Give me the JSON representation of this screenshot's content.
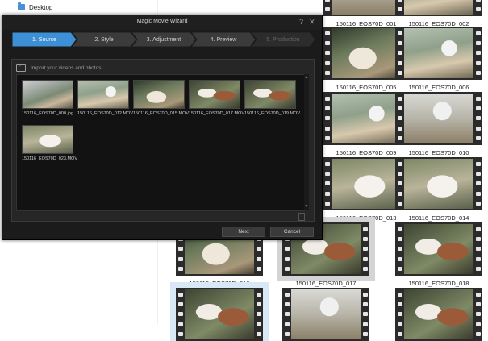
{
  "explorer": {
    "nav_desktop": "Desktop",
    "tiles": [
      {
        "label": "",
        "palette": "p6"
      },
      {
        "label": "150116_EOS70D_001",
        "palette": "p6"
      },
      {
        "label": "150116_EOS70D_002",
        "palette": "p2"
      },
      {
        "label": "150116_EOS70D_005",
        "palette": "p3"
      },
      {
        "label": "150116_EOS70D_006",
        "palette": "p2"
      },
      {
        "label": "150116_EOS70D_009",
        "palette": "p2"
      },
      {
        "label": "150116_EOS70D_010",
        "palette": "p6"
      },
      {
        "label": "150116_EOS70D_013",
        "palette": "p5"
      },
      {
        "label": "150116_EOS70D_014",
        "palette": "p5"
      },
      {
        "label": "150116_EOS70D_016",
        "palette": "p3"
      },
      {
        "label": "150116_EOS70D_017",
        "palette": "p4"
      },
      {
        "label": "150116_EOS70D_018",
        "palette": "p4"
      },
      {
        "label": "",
        "palette": "p4"
      },
      {
        "label": "",
        "palette": "p6"
      },
      {
        "label": "",
        "palette": "p4"
      }
    ]
  },
  "wizard": {
    "title": "Magic Movie Wizard",
    "help_glyph": "?",
    "close_glyph": "✕",
    "steps": [
      {
        "label": "1. Source",
        "state": "active"
      },
      {
        "label": "2. Style",
        "state": "normal"
      },
      {
        "label": "3. Adjustment",
        "state": "normal"
      },
      {
        "label": "4. Preview",
        "state": "normal"
      },
      {
        "label": "5. Production",
        "state": "disabled"
      }
    ],
    "import_label": "Import your videos and photos",
    "media": [
      {
        "name": "150116_EOS70D_000.jpg",
        "palette": "p1"
      },
      {
        "name": "150116_EOS70D_012.MOV",
        "palette": "p2"
      },
      {
        "name": "150116_EOS70D_015.MOV",
        "palette": "p3"
      },
      {
        "name": "150116_EOS70D_017.MOV",
        "palette": "p4"
      },
      {
        "name": "150116_EOS70D_019.MOV",
        "palette": "p4"
      },
      {
        "name": "150116_EOS70D_023.MOV",
        "palette": "p5"
      }
    ],
    "next_label": "Next",
    "cancel_label": "Cancel",
    "colors": {
      "accent": "#3d8fd6",
      "step_normal": "#3b3b3b",
      "step_disabled": "#2c2c2c"
    }
  }
}
